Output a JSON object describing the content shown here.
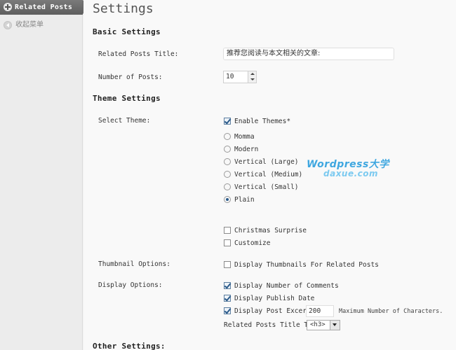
{
  "sidebar": {
    "active_item": "Related Posts",
    "collapse_label": "收起菜单"
  },
  "page": {
    "title": "Settings"
  },
  "basic": {
    "title": "Basic Settings",
    "related_title_label": "Related Posts Title:",
    "related_title_value": "推荐您阅读与本文相关的文章:",
    "num_posts_label": "Number of Posts:",
    "num_posts_value": "10"
  },
  "theme": {
    "title": "Theme Settings",
    "select_label": "Select Theme:",
    "enable_themes": "Enable Themes*",
    "options": [
      "Momma",
      "Modern",
      "Vertical (Large)",
      "Vertical (Medium)",
      "Vertical (Small)",
      "Plain"
    ],
    "selected_option": "Plain",
    "christmas": "Christmas Surprise",
    "customize": "Customize"
  },
  "thumbnail": {
    "label": "Thumbnail Options:",
    "option": "Display Thumbnails For Related Posts"
  },
  "display": {
    "label": "Display Options:",
    "comments": "Display Number of Comments",
    "publish_date": "Display Publish Date",
    "excerpt": "Display Post Excerpt",
    "excerpt_length": "200",
    "excerpt_hint": "Maximum Number of Characters.",
    "title_tag_label": "Related Posts Title Tag",
    "title_tag_value": "<h3>"
  },
  "other": {
    "title": "Other Settings:"
  },
  "watermark": {
    "line1": "Wordpress大学",
    "line2": "daxue.com"
  }
}
